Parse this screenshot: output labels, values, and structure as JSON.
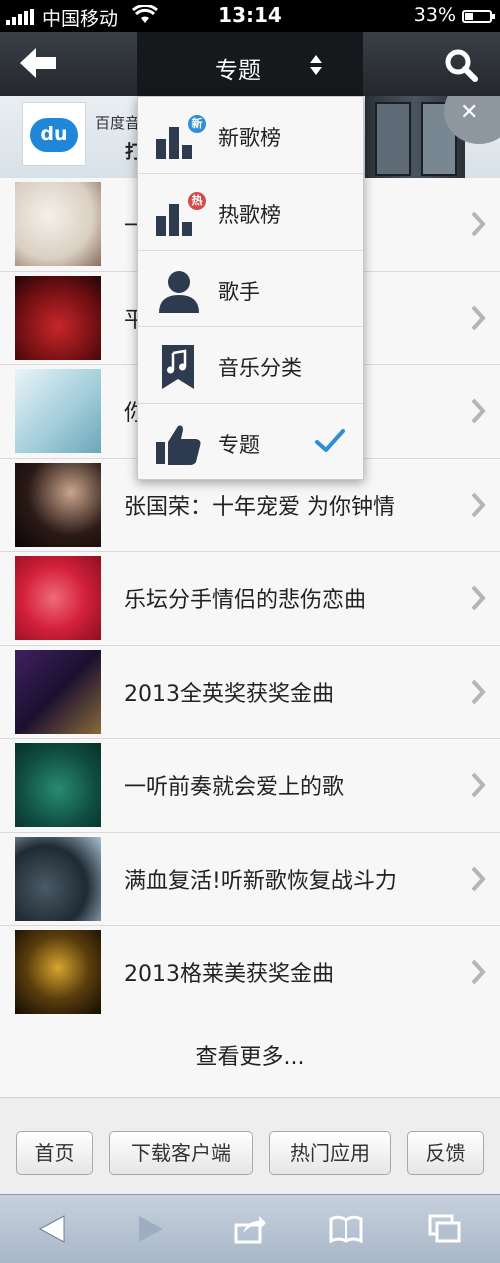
{
  "status_bar": {
    "carrier": "中国移动",
    "time": "13:14",
    "battery": "33%",
    "battery_level": 0.33
  },
  "nav": {
    "title": "专题"
  },
  "ad": {
    "logo_text": "du",
    "text": "百度音",
    "subtext": "打"
  },
  "menu": {
    "items": [
      {
        "label": "新歌榜",
        "icon": "chart-new-icon",
        "badge": "新",
        "badge_color": "#2f8fd6"
      },
      {
        "label": "热歌榜",
        "icon": "chart-hot-icon",
        "badge": "热",
        "badge_color": "#d64a4a"
      },
      {
        "label": "歌手",
        "icon": "singer-icon"
      },
      {
        "label": "音乐分类",
        "icon": "music-category-icon"
      },
      {
        "label": "专题",
        "icon": "thumbs-up-icon",
        "selected": true
      }
    ]
  },
  "list": {
    "rows": [
      {
        "title": "一                            歌曲精选"
      },
      {
        "title": "平                            我人生..."
      },
      {
        "title": "你                            歌"
      },
      {
        "title": "张国荣：十年宠爱 为你钟情"
      },
      {
        "title": "乐坛分手情侣的悲伤恋曲"
      },
      {
        "title": "2013全英奖获奖金曲"
      },
      {
        "title": "一听前奏就会爱上的歌"
      },
      {
        "title": "满血复活!听新歌恢复战斗力"
      },
      {
        "title": "2013格莱美获奖金曲"
      }
    ],
    "more": "查看更多..."
  },
  "footer": {
    "buttons": [
      "首页",
      "下载客户端",
      "热门应用",
      "反馈"
    ]
  },
  "colors": {
    "accent": "#2f8fd6",
    "nav_bg": "#2c3137",
    "icon": "#2e3a4e"
  }
}
